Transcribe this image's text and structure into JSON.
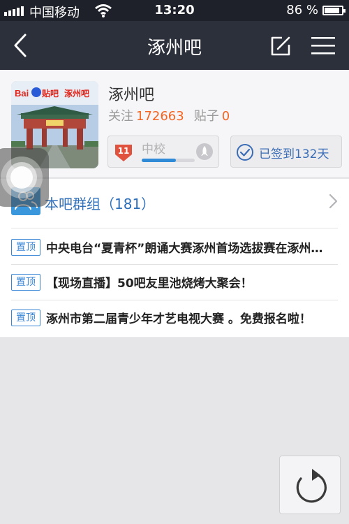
{
  "status_bar": {
    "carrier": "中国移动",
    "time": "13:20",
    "battery_percent": "86 %",
    "battery_level": 0.86
  },
  "nav": {
    "title": "涿州吧"
  },
  "forum": {
    "name": "涿州吧",
    "follow_label": "关注",
    "follow_count": "172663",
    "posts_label": "贴子",
    "posts_count": "0",
    "avatar_banner_text": "Baidu贴吧 涿州吧",
    "level": {
      "badge_number": "11",
      "name": "中校",
      "progress": 0.65
    },
    "signin_label": "已签到132天"
  },
  "group": {
    "label": "本吧群组（181）"
  },
  "pinned_tag": "置顶",
  "pinned_posts": [
    {
      "title": "中央电台“夏青杯”朗诵大赛涿州首场选拔赛在涿州…"
    },
    {
      "title": "【现场直播】50吧友里池烧烤大聚会！"
    },
    {
      "title": "涿州市第二届青少年才艺电视大赛 。免费报名啦！"
    }
  ],
  "colors": {
    "nav_bg": "#2c303b",
    "accent_blue": "#2f6fb9",
    "count_orange": "#f26522"
  },
  "icons": [
    "signal-icon",
    "wifi-icon",
    "battery-icon",
    "back-icon",
    "compose-icon",
    "menu-icon",
    "level-badge-icon",
    "rocket-icon",
    "check-circle-icon",
    "group-icon",
    "chevron-right-icon",
    "assistive-touch-icon",
    "refresh-icon"
  ]
}
